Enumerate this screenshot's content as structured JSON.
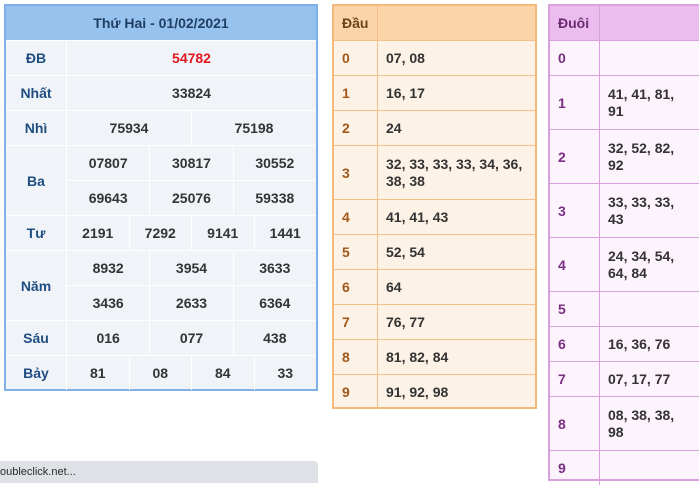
{
  "results": {
    "title": "Thứ Hai - 01/02/2021",
    "rows": [
      {
        "label": "ĐB",
        "lines": [
          [
            "54782"
          ]
        ]
      },
      {
        "label": "Nhất",
        "lines": [
          [
            "33824"
          ]
        ]
      },
      {
        "label": "Nhì",
        "lines": [
          [
            "75934",
            "75198"
          ]
        ]
      },
      {
        "label": "Ba",
        "lines": [
          [
            "07807",
            "30817",
            "30552"
          ],
          [
            "69643",
            "25076",
            "59338"
          ]
        ]
      },
      {
        "label": "Tư",
        "lines": [
          [
            "2191",
            "7292",
            "9141",
            "1441"
          ]
        ]
      },
      {
        "label": "Năm",
        "lines": [
          [
            "8932",
            "3954",
            "3633"
          ],
          [
            "3436",
            "2633",
            "6364"
          ]
        ]
      },
      {
        "label": "Sáu",
        "lines": [
          [
            "016",
            "077",
            "438"
          ]
        ]
      },
      {
        "label": "Bảy",
        "lines": [
          [
            "81",
            "08",
            "84",
            "33"
          ]
        ]
      }
    ]
  },
  "dau": {
    "header": "Đầu",
    "rows": [
      {
        "key": "0",
        "value": "07, 08"
      },
      {
        "key": "1",
        "value": "16, 17"
      },
      {
        "key": "2",
        "value": "24"
      },
      {
        "key": "3",
        "value": "32, 33, 33, 33, 34, 36, 38, 38"
      },
      {
        "key": "4",
        "value": "41, 41, 43"
      },
      {
        "key": "5",
        "value": "52, 54"
      },
      {
        "key": "6",
        "value": "64"
      },
      {
        "key": "7",
        "value": "76, 77"
      },
      {
        "key": "8",
        "value": "81, 82, 84"
      },
      {
        "key": "9",
        "value": "91, 92, 98"
      }
    ]
  },
  "duoi": {
    "header": "Đuôi",
    "rows": [
      {
        "key": "0",
        "value": ""
      },
      {
        "key": "1",
        "value": "41, 41, 81, 91"
      },
      {
        "key": "2",
        "value": "32, 52, 82, 92"
      },
      {
        "key": "3",
        "value": "33, 33, 33, 43"
      },
      {
        "key": "4",
        "value": "24, 34, 54, 64, 84"
      },
      {
        "key": "5",
        "value": ""
      },
      {
        "key": "6",
        "value": "16, 36, 76"
      },
      {
        "key": "7",
        "value": "07, 17, 77"
      },
      {
        "key": "8",
        "value": "08, 38, 38, 98"
      },
      {
        "key": "9",
        "value": ""
      }
    ]
  },
  "status_bar": {
    "text": "oubleclick.net..."
  }
}
